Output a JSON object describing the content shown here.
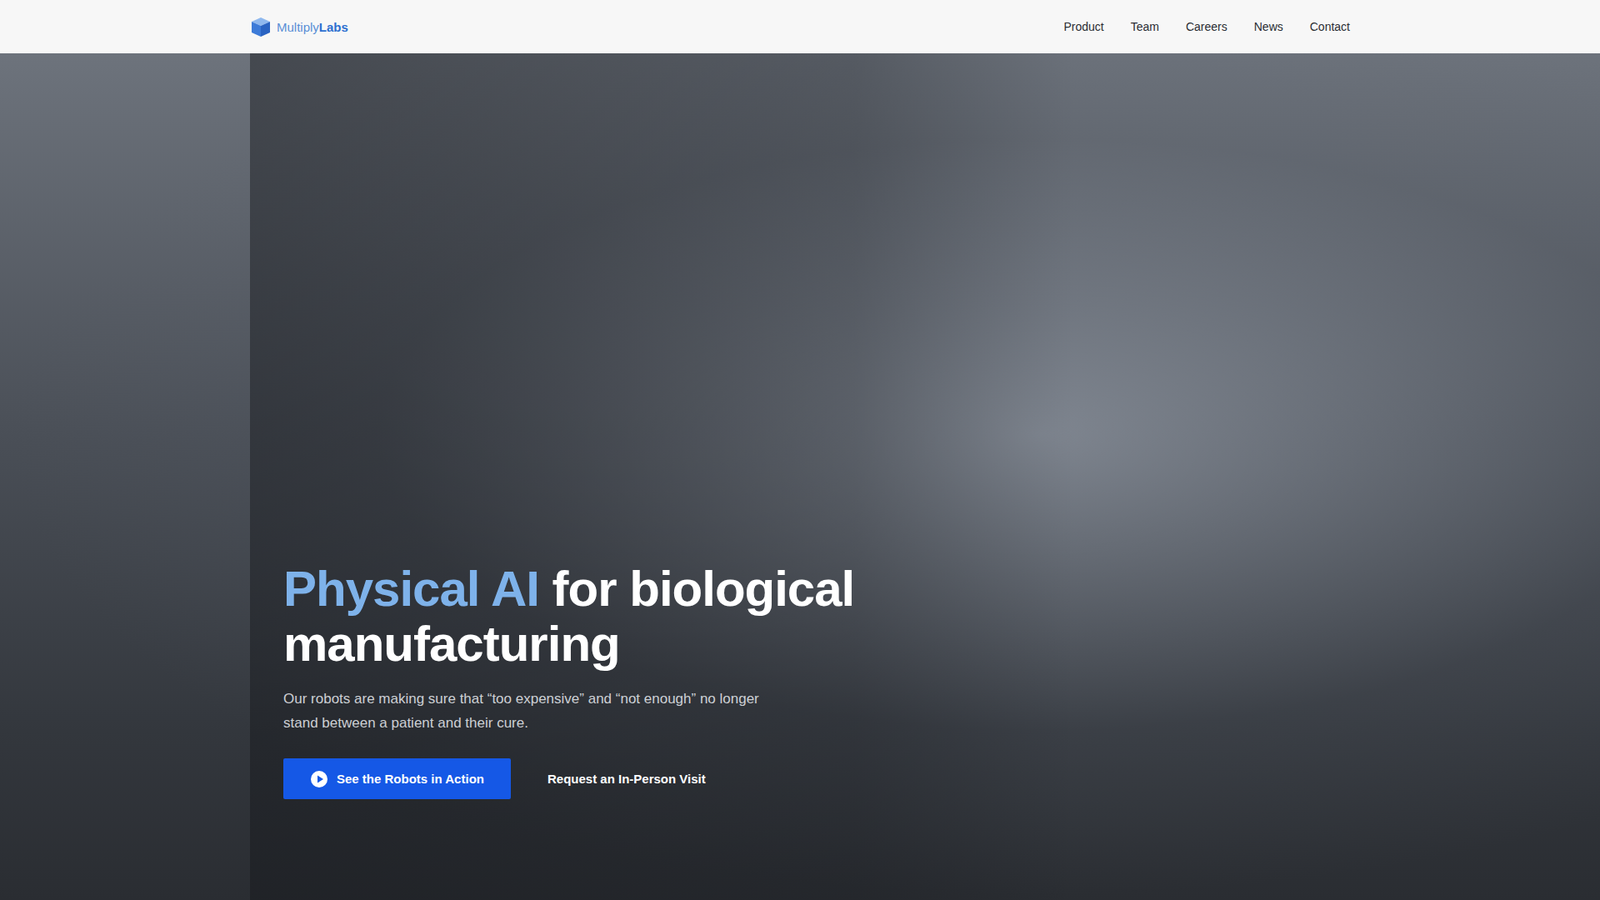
{
  "header": {
    "logo": {
      "first": "Multiply",
      "second": "Labs"
    },
    "nav": [
      {
        "label": "Product"
      },
      {
        "label": "Team"
      },
      {
        "label": "Careers"
      },
      {
        "label": "News"
      },
      {
        "label": "Contact"
      }
    ]
  },
  "hero": {
    "title_highlight": "Physical AI",
    "title_rest": "for biological manufacturing",
    "subtitle": "Our robots are making sure that “too expensive” and “not enough” no longer stand between a patient and their cure.",
    "buttons": [
      {
        "label": "See the Robots in Action",
        "kind": "primary"
      },
      {
        "label": "Request an In-Person Visit",
        "kind": "link"
      }
    ]
  }
}
